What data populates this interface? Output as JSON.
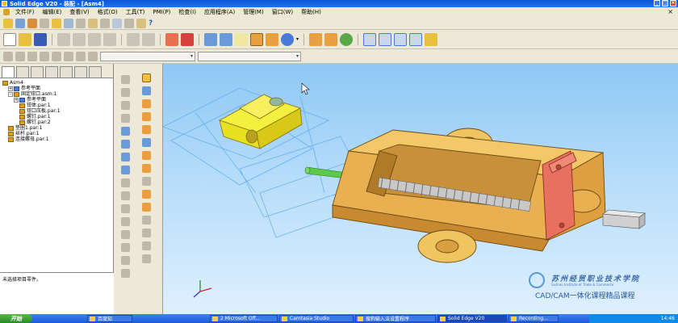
{
  "title_bar": {
    "title": "Solid Edge V20 - 装配 - [Asm4]",
    "min": "_",
    "max": "□",
    "close": "×"
  },
  "menu": {
    "items": [
      "文件(F)",
      "编辑(E)",
      "查看(V)",
      "格式(O)",
      "工具(T)",
      "PMI(P)",
      "检查(I)",
      "应用程序(A)",
      "管理(M)",
      "窗口(W)",
      "帮助(H)"
    ],
    "close_glyph": "×"
  },
  "toolbar": {
    "help_glyph": "?",
    "arrow_glyph": "▾"
  },
  "pathfinder": {
    "tree": [
      {
        "text": "Asm4",
        "indent": 0,
        "toggle": "",
        "icon": "assembly"
      },
      {
        "text": "参考平面",
        "indent": 1,
        "toggle": "+",
        "icon": "blue"
      },
      {
        "text": "固定钳口.asm:1",
        "indent": 1,
        "toggle": "-",
        "icon": "part"
      },
      {
        "text": "参考平面",
        "indent": 2,
        "toggle": "+",
        "icon": "blue"
      },
      {
        "text": "钳体.par:1",
        "indent": 3,
        "toggle": "",
        "icon": "part"
      },
      {
        "text": "钳口压板.par:1",
        "indent": 3,
        "toggle": "",
        "icon": "part"
      },
      {
        "text": "螺钉.par:1",
        "indent": 3,
        "toggle": "",
        "icon": "part"
      },
      {
        "text": "螺钉.par:2",
        "indent": 3,
        "toggle": "",
        "icon": "part"
      },
      {
        "text": "垫圈1.par:1",
        "indent": 1,
        "toggle": "",
        "icon": "part"
      },
      {
        "text": "丝杆.par:1",
        "indent": 1,
        "toggle": "",
        "icon": "part"
      },
      {
        "text": "连接螺母.par:1",
        "indent": 1,
        "toggle": "",
        "icon": "part"
      }
    ],
    "status": "未选择项目零件。"
  },
  "watermark": {
    "school_cn": "苏州经贸职业技术学院",
    "school_en": "Suzhou Institute of Trade & Commerce",
    "course": "CAD/CAM一体化课程精品课程"
  },
  "taskbar": {
    "start": "开始",
    "items": [
      "百度知",
      "2 Microsoft Off...",
      "Camtasia Studio",
      "搜狗输入法设置程序",
      "Solid Edge V20",
      "Recording..."
    ],
    "time": "14:46"
  },
  "colors": {
    "part_yellow": "#f0c060",
    "jaw_red": "#e87060",
    "sky_top": "#8ec8f4"
  }
}
